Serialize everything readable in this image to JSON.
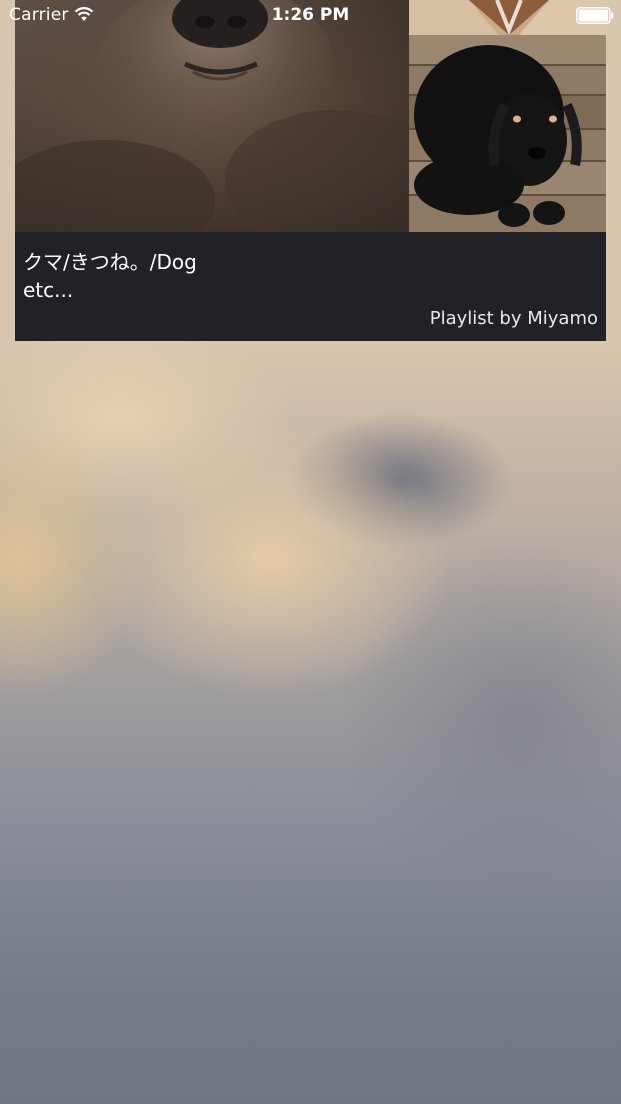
{
  "status_bar": {
    "carrier": "Carrier",
    "time": "1:26 PM",
    "wifi_icon": "wifi-icon",
    "battery_icon": "battery-icon"
  },
  "playlist_card": {
    "title": "クマ/きつね。/Dog\netc...",
    "credit": "Playlist by Miyamo",
    "artwork": [
      "bear-photo",
      "fox-photo",
      "black-puppy-photo"
    ]
  },
  "colors": {
    "card_background": "#212227",
    "text": "#ffffff"
  }
}
